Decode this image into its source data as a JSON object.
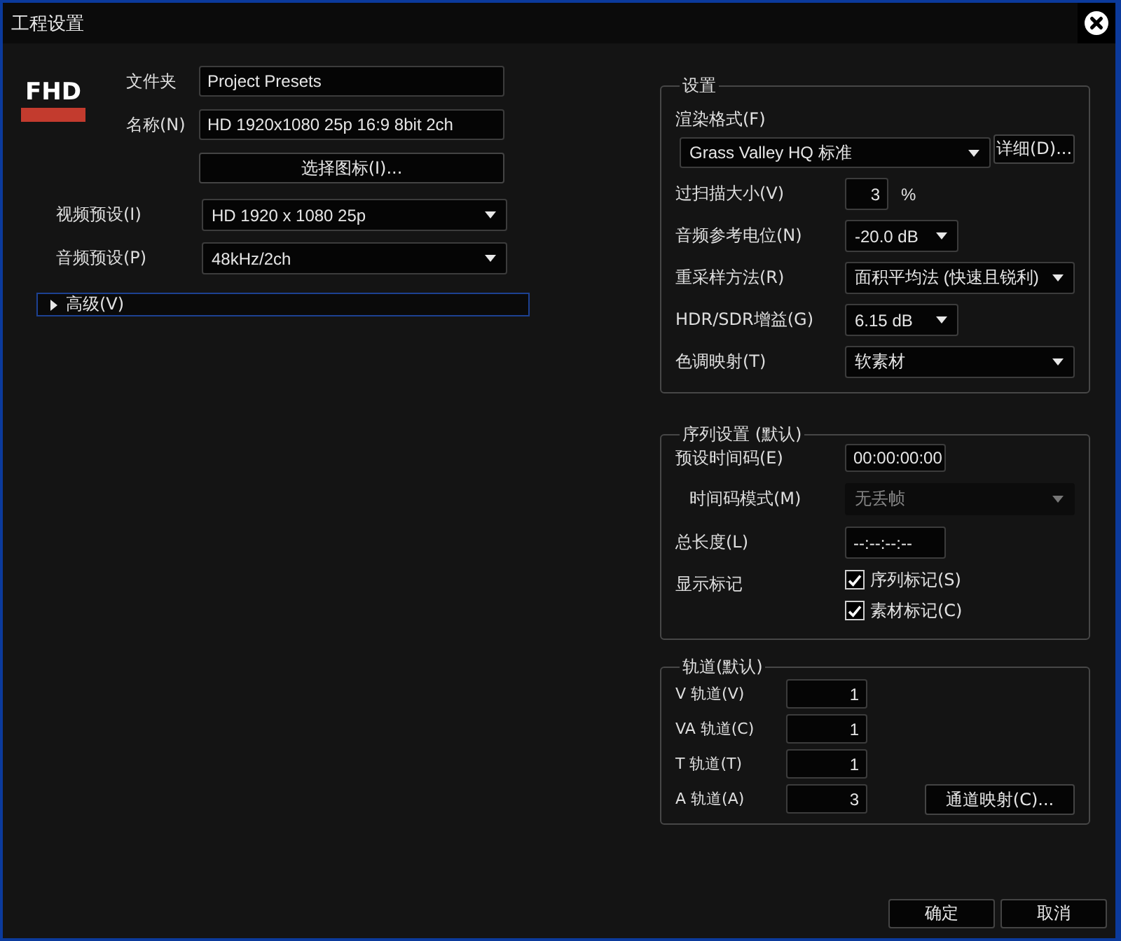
{
  "window": {
    "title": "工程设置"
  },
  "logo": {
    "text": "FHD"
  },
  "project": [
    {
      "kind": "text",
      "label": "文件夹",
      "value": "Project Presets"
    },
    {
      "kind": "text",
      "label": "名称(N)",
      "value": "HD 1920x1080 25p 16:9 8bit 2ch"
    },
    {
      "kind": "button",
      "text": "选择图标(I)..."
    }
  ],
  "presets": [
    {
      "label": "视频预设(I)",
      "value": "HD 1920 x 1080 25p"
    },
    {
      "label": "音频预设(P)",
      "value": "48kHz/2ch"
    }
  ],
  "advanced": {
    "label": "高级(V)",
    "expanded": false
  },
  "settings": {
    "title": "设置",
    "render_format": {
      "label": "渲染格式(F)",
      "value": "Grass Valley HQ 标准",
      "details_button": "详细(D)..."
    },
    "rows": [
      {
        "kind": "number",
        "label": "过扫描大小(V)",
        "value": "3",
        "unit": "%"
      },
      {
        "kind": "dropdown",
        "label": "音频参考电位(N)",
        "value": "-20.0 dB"
      },
      {
        "kind": "dropdown",
        "label": "重采样方法(R)",
        "value": "面积平均法 (快速且锐利)"
      },
      {
        "kind": "dropdown",
        "label": "HDR/SDR增益(G)",
        "value": "6.15 dB"
      },
      {
        "kind": "dropdown",
        "label": "色调映射(T)",
        "value": "软素材"
      }
    ]
  },
  "sequence": {
    "title": "序列设置 (默认)",
    "rows": [
      {
        "kind": "timecode",
        "label": "预设时间码(E)",
        "value": "00:00:00:00",
        "disabled": false
      },
      {
        "kind": "dropdown",
        "label": "时间码模式(M)",
        "value": "无丢帧",
        "disabled": true
      },
      {
        "kind": "timecode",
        "label": "总长度(L)",
        "value": "--:--:--:--",
        "disabled": false
      }
    ],
    "markers": {
      "label": "显示标记",
      "options": [
        {
          "label": "序列标记(S)",
          "checked": true
        },
        {
          "label": "素材标记(C)",
          "checked": true
        }
      ]
    }
  },
  "tracks": {
    "title": "轨道(默认)",
    "rows": [
      {
        "label": "V 轨道(V)",
        "value": "1"
      },
      {
        "label": "VA 轨道(C)",
        "value": "1"
      },
      {
        "label": "T 轨道(T)",
        "value": "1"
      },
      {
        "label": "A 轨道(A)",
        "value": "3"
      }
    ],
    "channel_map_button": "通道映射(C)..."
  },
  "buttons": [
    "确定",
    "取消"
  ]
}
